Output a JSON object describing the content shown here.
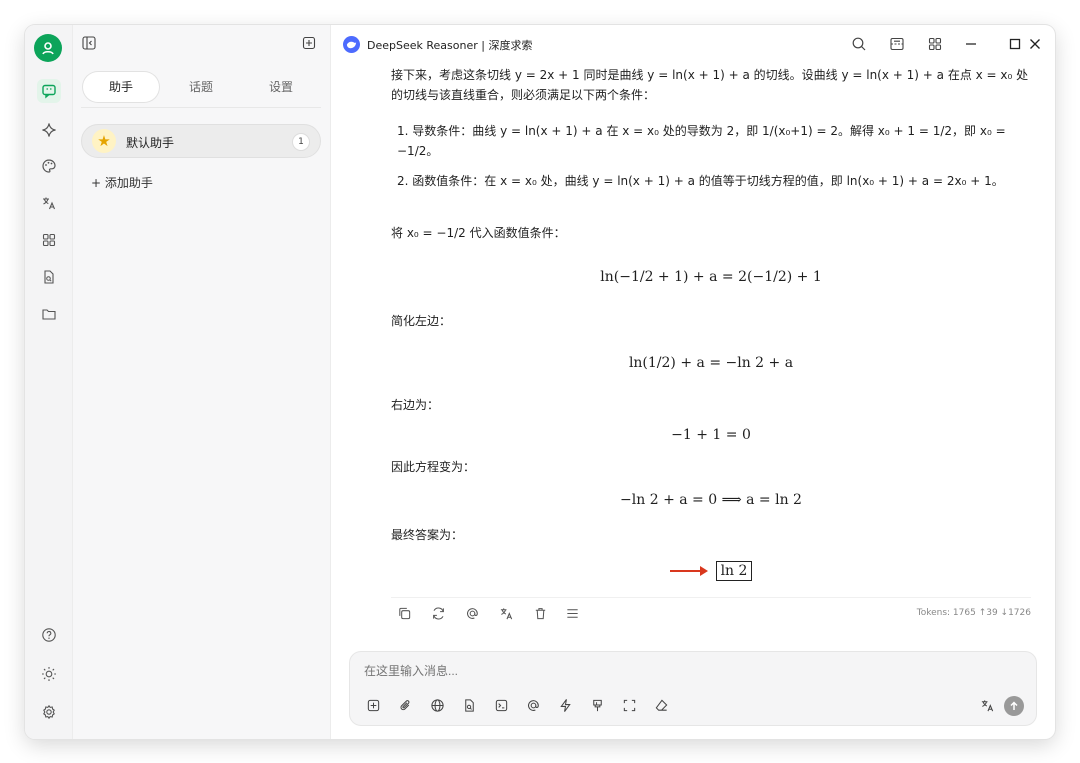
{
  "window": {
    "title": "DeepSeek Reasoner | 深度求索"
  },
  "panel": {
    "tabs": [
      {
        "label": "助手",
        "active": true
      },
      {
        "label": "话题",
        "active": false
      },
      {
        "label": "设置",
        "active": false
      }
    ],
    "assistant": {
      "name": "默认助手",
      "count": "1"
    },
    "add_label": "+ 添加助手"
  },
  "message": {
    "intro": "接下来，考虑这条切线 y = 2x + 1 同时是曲线 y = ln(x + 1) + a 的切线。设曲线 y = ln(x + 1) + a 在点 x = x₀ 处的切线与该直线重合，则必须满足以下两个条件：",
    "item1": "1. 导数条件：曲线 y = ln(x + 1) + a 在 x = x₀ 处的导数为 2，即 1/(x₀+1) = 2。解得 x₀ + 1 = 1/2，即 x₀ = −1/2。",
    "item2": "2. 函数值条件：在 x = x₀ 处，曲线 y = ln(x + 1) + a 的值等于切线方程的值，即 ln(x₀ + 1) + a = 2x₀ + 1。",
    "substitute": "将 x₀ = −1/2 代入函数值条件：",
    "eq1": "ln(−1/2 + 1) + a = 2(−1/2) + 1",
    "simplify_left": "简化左边：",
    "eq2": "ln(1/2) + a = −ln 2 + a",
    "right_side": "右边为：",
    "eq3": "−1 + 1 = 0",
    "therefore": "因此方程变为：",
    "eq4": "−ln 2 + a = 0 ⟹ a = ln 2",
    "final": "最终答案为：",
    "answer": "ln 2"
  },
  "tokens": "Tokens: 1765 ↑39 ↓1726",
  "input": {
    "placeholder": "在这里输入消息..."
  },
  "colors": {
    "brand": "#0ca45a",
    "deepseek": "#4d6bfe",
    "arrow": "#d9381e"
  }
}
